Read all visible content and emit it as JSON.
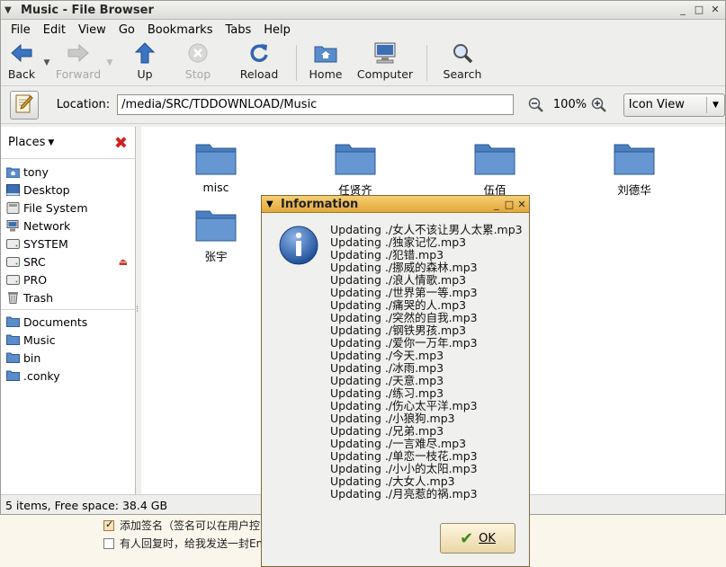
{
  "window": {
    "title": "Music - File Browser"
  },
  "menubar": {
    "items": [
      {
        "label": "File"
      },
      {
        "label": "Edit"
      },
      {
        "label": "View"
      },
      {
        "label": "Go"
      },
      {
        "label": "Bookmarks"
      },
      {
        "label": "Tabs"
      },
      {
        "label": "Help"
      }
    ]
  },
  "toolbar": {
    "back": "Back",
    "forward": "Forward",
    "up": "Up",
    "stop": "Stop",
    "reload": "Reload",
    "home": "Home",
    "computer": "Computer",
    "search": "Search"
  },
  "location": {
    "label": "Location:",
    "path": "/media/SRC/TDDOWNLOAD/Music",
    "zoom": "100%",
    "view_mode": "Icon View"
  },
  "sidebar": {
    "header": "Places",
    "places": [
      {
        "label": "tony",
        "icon": "home-folder-icon"
      },
      {
        "label": "Desktop",
        "icon": "desktop-icon"
      },
      {
        "label": "File System",
        "icon": "filesystem-icon"
      },
      {
        "label": "Network",
        "icon": "network-icon"
      },
      {
        "label": "SYSTEM",
        "icon": "drive-icon"
      },
      {
        "label": "SRC",
        "icon": "drive-icon"
      },
      {
        "label": "PRO",
        "icon": "drive-icon"
      },
      {
        "label": "Trash",
        "icon": "trash-icon"
      }
    ],
    "bookmarks": [
      {
        "label": "Documents"
      },
      {
        "label": "Music"
      },
      {
        "label": "bin"
      },
      {
        "label": ".conky"
      }
    ]
  },
  "files": [
    {
      "name": "misc"
    },
    {
      "name": "任贤齐"
    },
    {
      "name": "伍佰"
    },
    {
      "name": "刘德华"
    },
    {
      "name": "张宇"
    }
  ],
  "status": "5 items, Free space: 38.4 GB",
  "background_page": {
    "row1": "添加签名（签名可以在用户控",
    "row2": "有人回复时，给我发送一封Em"
  },
  "dialog": {
    "title": "Information",
    "lines": [
      "Updating ./女人不该让男人太累.mp3",
      "Updating ./独家记忆.mp3",
      "Updating ./犯错.mp3",
      "Updating ./挪威的森林.mp3",
      "Updating ./浪人情歌.mp3",
      "Updating ./世界第一等.mp3",
      "Updating ./痛哭的人.mp3",
      "Updating ./突然的自我.mp3",
      "Updating ./钢铁男孩.mp3",
      "Updating ./爱你一万年.mp3",
      "Updating ./今天.mp3",
      "Updating ./冰雨.mp3",
      "Updating ./天意.mp3",
      "Updating ./练习.mp3",
      "Updating ./伤心太平洋.mp3",
      "Updating ./小狼狗.mp3",
      "Updating ./兄弟.mp3",
      "Updating ./一言难尽.mp3",
      "Updating ./单恋一枝花.mp3",
      "Updating ./小小的太阳.mp3",
      "Updating ./大女人.mp3",
      "Updating ./月亮惹的祸.mp3"
    ],
    "ok": "OK"
  },
  "colors": {
    "folder_blue": "#4a7fc0",
    "dialog_title": "#e8b44a",
    "close_red": "#d02020"
  }
}
